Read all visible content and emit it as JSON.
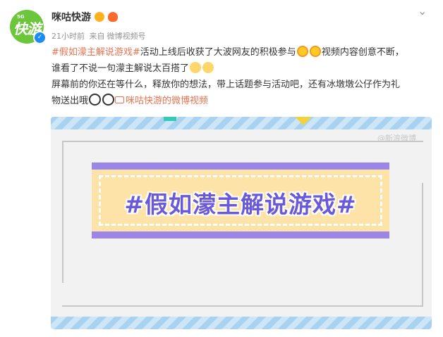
{
  "header": {
    "avatar_label": "快游",
    "avatar_tag": "5G",
    "account_name": "咪咕快游",
    "timestamp": "21小时前",
    "source_prefix": "来自",
    "source_name": "微博视频号"
  },
  "post": {
    "topic_tag": "#假如濛主解说游戏#",
    "line1_text": "活动上线后收获了大波网友的积极参与",
    "line1_tail": "视频内容创意不断，",
    "line2_text": "谁看了不说一句濛主解说太百搭了",
    "line3_text": "屏幕前的你还在等什么，释放你的想法，带上话题参与活动吧，还有冰墩墩公仔作为礼",
    "line4_text": "物送出哦",
    "video_link": "咪咕快游的微博视频"
  },
  "video": {
    "watermark": "@新浪微博",
    "title": "#假如濛主解说游戏#"
  },
  "colors": {
    "link": "#eb7350",
    "accent_purple": "#9b85e6",
    "title_text": "#6a59d8",
    "band_yellow": "#fde3a7",
    "avatar_green": "#6cc63b"
  },
  "icons": {
    "more": "chevron-down-icon",
    "verified": "verified-badge-icon",
    "emoji_surprise": "surprised-face-emoji",
    "emoji_cat": "cat-face-emoji",
    "emoji_panda": "panda-emoji",
    "video_link": "video-link-icon"
  }
}
